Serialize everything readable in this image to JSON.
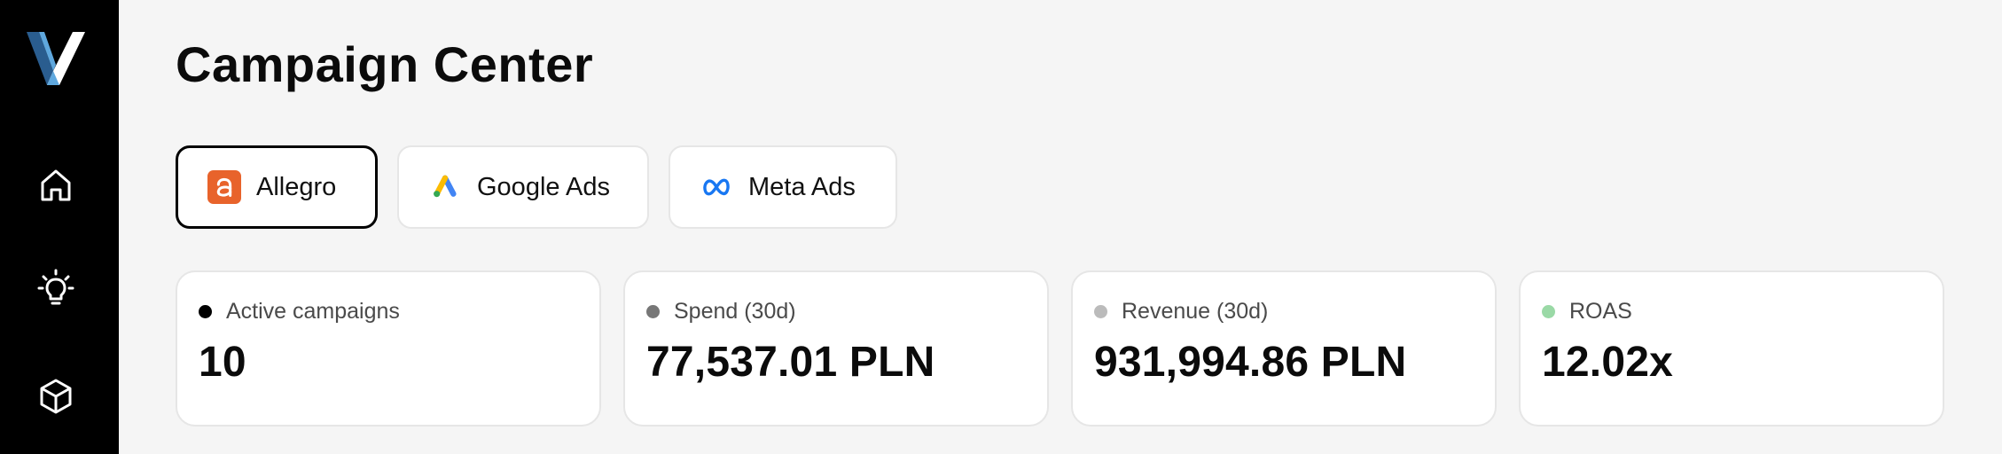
{
  "app": {
    "logo_letter": "V",
    "colors": {
      "logo_dark": "#2a5d8f",
      "logo_light": "#5fa8de"
    }
  },
  "sidebar": {
    "items": [
      {
        "icon": "home-icon"
      },
      {
        "icon": "lightbulb-icon"
      },
      {
        "icon": "cube-icon"
      }
    ]
  },
  "page": {
    "title": "Campaign Center"
  },
  "tabs": [
    {
      "label": "Allegro",
      "icon": "allegro-icon",
      "active": true,
      "color": "#e8632b"
    },
    {
      "label": "Google Ads",
      "icon": "google-ads-icon",
      "active": false
    },
    {
      "label": "Meta Ads",
      "icon": "meta-icon",
      "active": false,
      "color": "#1877f2"
    }
  ],
  "stats": [
    {
      "label": "Active campaigns",
      "value": "10",
      "dot_color": "#000000"
    },
    {
      "label": "Spend (30d)",
      "value": "77,537.01 PLN",
      "dot_color": "#777777"
    },
    {
      "label": "Revenue (30d)",
      "value": "931,994.86 PLN",
      "dot_color": "#bbbbbb"
    },
    {
      "label": "ROAS",
      "value": "12.02x",
      "dot_color": "#9ad9a6"
    }
  ]
}
